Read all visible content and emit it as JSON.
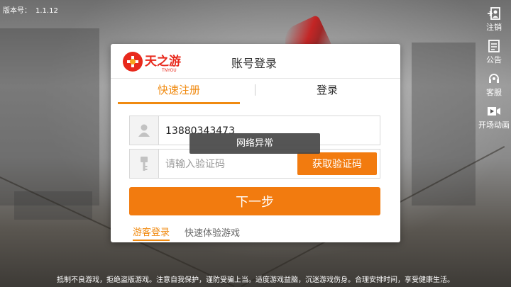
{
  "version": {
    "label": "版本号：",
    "number": "1.1.12"
  },
  "sidebar": {
    "items": [
      {
        "label": "注销",
        "icon": "logout-icon"
      },
      {
        "label": "公告",
        "icon": "notice-icon"
      },
      {
        "label": "客服",
        "icon": "headset-icon"
      },
      {
        "label": "开场动画",
        "icon": "video-icon"
      }
    ]
  },
  "dialog": {
    "logo_text": "天之游",
    "logo_sub": "TNYOU",
    "title": "账号登录",
    "tabs": [
      {
        "label": "快速注册",
        "active": true
      },
      {
        "label": "登录",
        "active": false
      }
    ],
    "phone": {
      "value": "13880343473",
      "icon": "user-icon"
    },
    "code": {
      "placeholder": "请输入验证码",
      "value": "",
      "icon": "key-icon"
    },
    "get_code_label": "获取验证码",
    "next_label": "下一步",
    "guest_label": "游客登录",
    "guest_sub": "快速体验游戏"
  },
  "toast": "网络异常",
  "footer": "抵制不良游戏，拒绝盗版游戏。注意自我保护，谨防受骗上当。适度游戏益脑，沉迷游戏伤身。合理安排时间，享受健康生活。",
  "colors": {
    "accent": "#f27b0f",
    "tab_active": "#f08a10"
  }
}
